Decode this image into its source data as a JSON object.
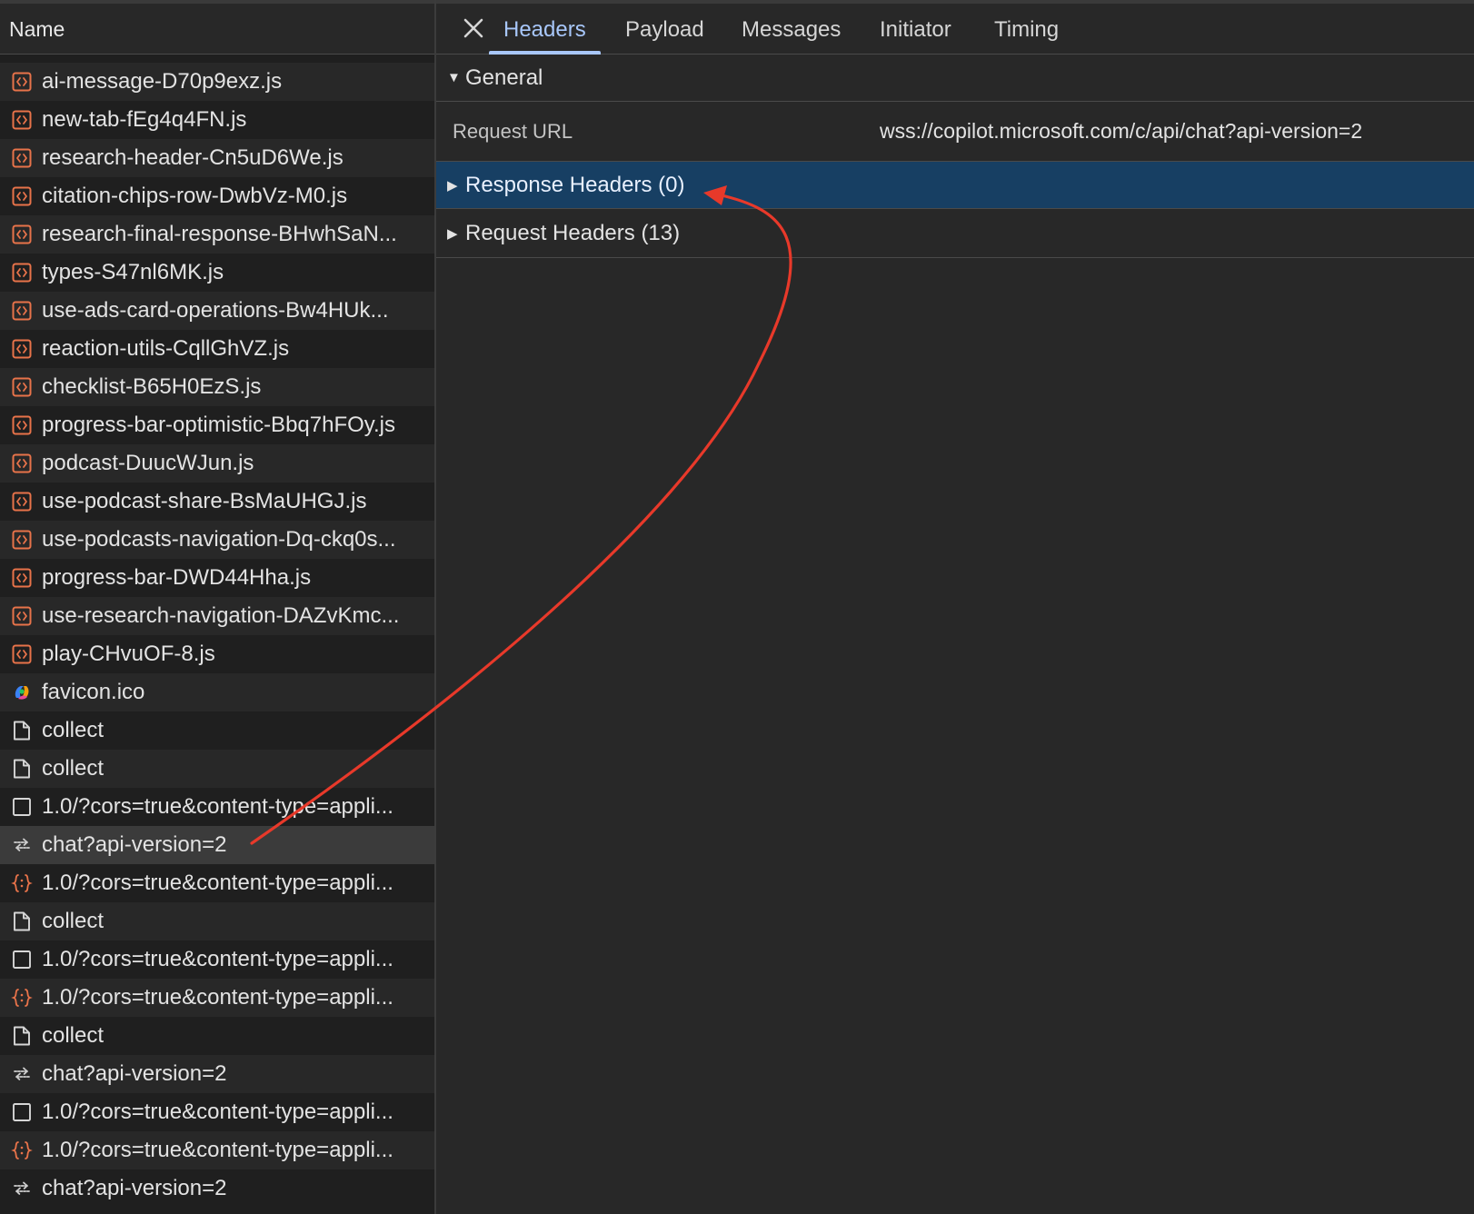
{
  "network_list": {
    "column_header": "Name",
    "rows": [
      {
        "label": "ai-message-D70p9exz.js",
        "icon": "script-icon"
      },
      {
        "label": "new-tab-fEg4q4FN.js",
        "icon": "script-icon"
      },
      {
        "label": "research-header-Cn5uD6We.js",
        "icon": "script-icon"
      },
      {
        "label": "citation-chips-row-DwbVz-M0.js",
        "icon": "script-icon"
      },
      {
        "label": "research-final-response-BHwhSaN...",
        "icon": "script-icon"
      },
      {
        "label": "types-S47nl6MK.js",
        "icon": "script-icon"
      },
      {
        "label": "use-ads-card-operations-Bw4HUk...",
        "icon": "script-icon"
      },
      {
        "label": "reaction-utils-CqllGhVZ.js",
        "icon": "script-icon"
      },
      {
        "label": "checklist-B65H0EzS.js",
        "icon": "script-icon"
      },
      {
        "label": "progress-bar-optimistic-Bbq7hFOy.js",
        "icon": "script-icon"
      },
      {
        "label": "podcast-DuucWJun.js",
        "icon": "script-icon"
      },
      {
        "label": "use-podcast-share-BsMaUHGJ.js",
        "icon": "script-icon"
      },
      {
        "label": "use-podcasts-navigation-Dq-ckq0s...",
        "icon": "script-icon"
      },
      {
        "label": "progress-bar-DWD44Hha.js",
        "icon": "script-icon"
      },
      {
        "label": "use-research-navigation-DAZvKmc...",
        "icon": "script-icon"
      },
      {
        "label": "play-CHvuOF-8.js",
        "icon": "script-icon"
      },
      {
        "label": "favicon.ico",
        "icon": "favicon-icon"
      },
      {
        "label": "collect",
        "icon": "document-icon"
      },
      {
        "label": "collect",
        "icon": "document-icon"
      },
      {
        "label": "1.0/?cors=true&content-type=appli...",
        "icon": "checkbox-square-icon"
      },
      {
        "label": "chat?api-version=2",
        "icon": "websocket-icon",
        "selected": true
      },
      {
        "label": "1.0/?cors=true&content-type=appli...",
        "icon": "fetch-braces-icon"
      },
      {
        "label": "collect",
        "icon": "document-icon"
      },
      {
        "label": "1.0/?cors=true&content-type=appli...",
        "icon": "checkbox-square-icon"
      },
      {
        "label": "1.0/?cors=true&content-type=appli...",
        "icon": "fetch-braces-icon"
      },
      {
        "label": "collect",
        "icon": "document-icon"
      },
      {
        "label": "chat?api-version=2",
        "icon": "websocket-icon"
      },
      {
        "label": "1.0/?cors=true&content-type=appli...",
        "icon": "checkbox-square-icon"
      },
      {
        "label": "1.0/?cors=true&content-type=appli...",
        "icon": "fetch-braces-icon"
      },
      {
        "label": "chat?api-version=2",
        "icon": "websocket-icon"
      }
    ]
  },
  "detail_panel": {
    "close_icon": "close-icon",
    "tabs": [
      {
        "label": "Headers",
        "active": true
      },
      {
        "label": "Payload"
      },
      {
        "label": "Messages"
      },
      {
        "label": "Initiator"
      },
      {
        "label": "Timing"
      }
    ],
    "general": {
      "label": "General",
      "request_url_key": "Request URL",
      "request_url_value": "wss://copilot.microsoft.com/c/api/chat?api-version=2"
    },
    "response_headers_label": "Response Headers (0)",
    "request_headers_label": "Request Headers (13)"
  },
  "colors": {
    "accent": "#a8c7fa",
    "selected_section_bg": "#173f63",
    "annotation_arrow": "#e8392a",
    "script_icon": "#e8734a"
  }
}
